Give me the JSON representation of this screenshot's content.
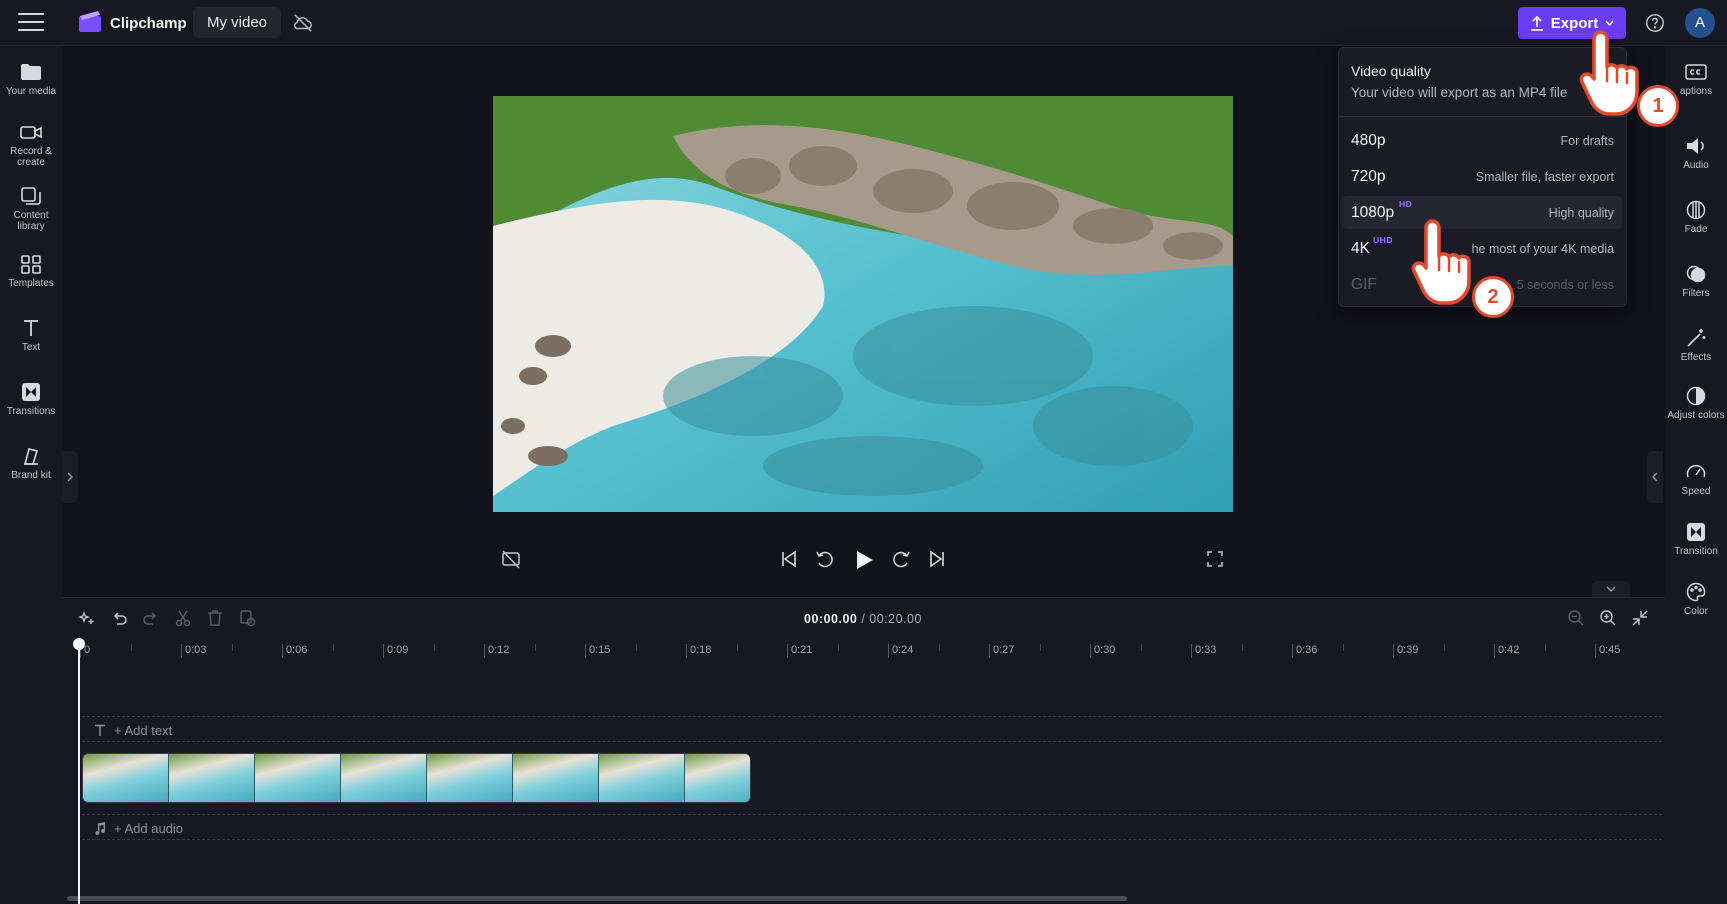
{
  "app": {
    "name": "Clipchamp",
    "project_title": "My video"
  },
  "header": {
    "export_label": "Export",
    "avatar_initial": "A"
  },
  "left_sidebar": {
    "items": [
      {
        "label": "Your media",
        "icon": "folder-icon"
      },
      {
        "label": "Record & create",
        "icon": "camera-icon"
      },
      {
        "label": "Content library",
        "icon": "library-icon"
      },
      {
        "label": "Templates",
        "icon": "templates-icon"
      },
      {
        "label": "Text",
        "icon": "text-icon"
      },
      {
        "label": "Transitions",
        "icon": "transitions-icon"
      },
      {
        "label": "Brand kit",
        "icon": "brand-kit-icon"
      }
    ]
  },
  "right_sidebar": {
    "items": [
      {
        "label": "aptions",
        "icon": "captions-icon"
      },
      {
        "label": "Audio",
        "icon": "speaker-icon"
      },
      {
        "label": "Fade",
        "icon": "fade-icon"
      },
      {
        "label": "Filters",
        "icon": "filters-icon"
      },
      {
        "label": "Effects",
        "icon": "effects-icon"
      },
      {
        "label": "Adjust colors",
        "icon": "adjust-colors-icon"
      },
      {
        "label": "Speed",
        "icon": "speed-icon"
      },
      {
        "label": "Transition",
        "icon": "transition-icon"
      },
      {
        "label": "Color",
        "icon": "color-icon"
      }
    ]
  },
  "export_menu": {
    "title": "Video quality",
    "subtitle": "Your video will export as an MP4 file",
    "options": [
      {
        "label": "480p",
        "badge": "",
        "description": "For drafts",
        "state": "normal"
      },
      {
        "label": "720p",
        "badge": "",
        "description": "Smaller file, faster export",
        "state": "normal"
      },
      {
        "label": "1080p",
        "badge": "HD",
        "description": "High quality",
        "state": "hovered"
      },
      {
        "label": "4K",
        "badge": "UHD",
        "description": "he most of your 4K media",
        "state": "normal"
      },
      {
        "label": "GIF",
        "badge": "",
        "description": "5 seconds or less",
        "state": "disabled"
      }
    ]
  },
  "preview": {
    "image": "aerial tropical beach with rocks and turquoise water"
  },
  "timeline": {
    "current_time": "00:00.00",
    "separator": " / ",
    "total_time": "00:20.00",
    "ruler_labels": [
      "0",
      "0:03",
      "0:06",
      "0:09",
      "0:12",
      "0:15",
      "0:18",
      "0:21",
      "0:24",
      "0:27",
      "0:30",
      "0:33",
      "0:36",
      "0:39",
      "0:42",
      "0:45"
    ],
    "add_text_label": "+ Add text",
    "add_audio_label": "+ Add audio",
    "clip_thumbnails": 8
  },
  "callouts": [
    {
      "step": "1"
    },
    {
      "step": "2"
    }
  ],
  "colors": {
    "accent": "#6b3df2",
    "badge": "#9e72ff",
    "callout": "#e24a2b",
    "background": "#13131c"
  }
}
